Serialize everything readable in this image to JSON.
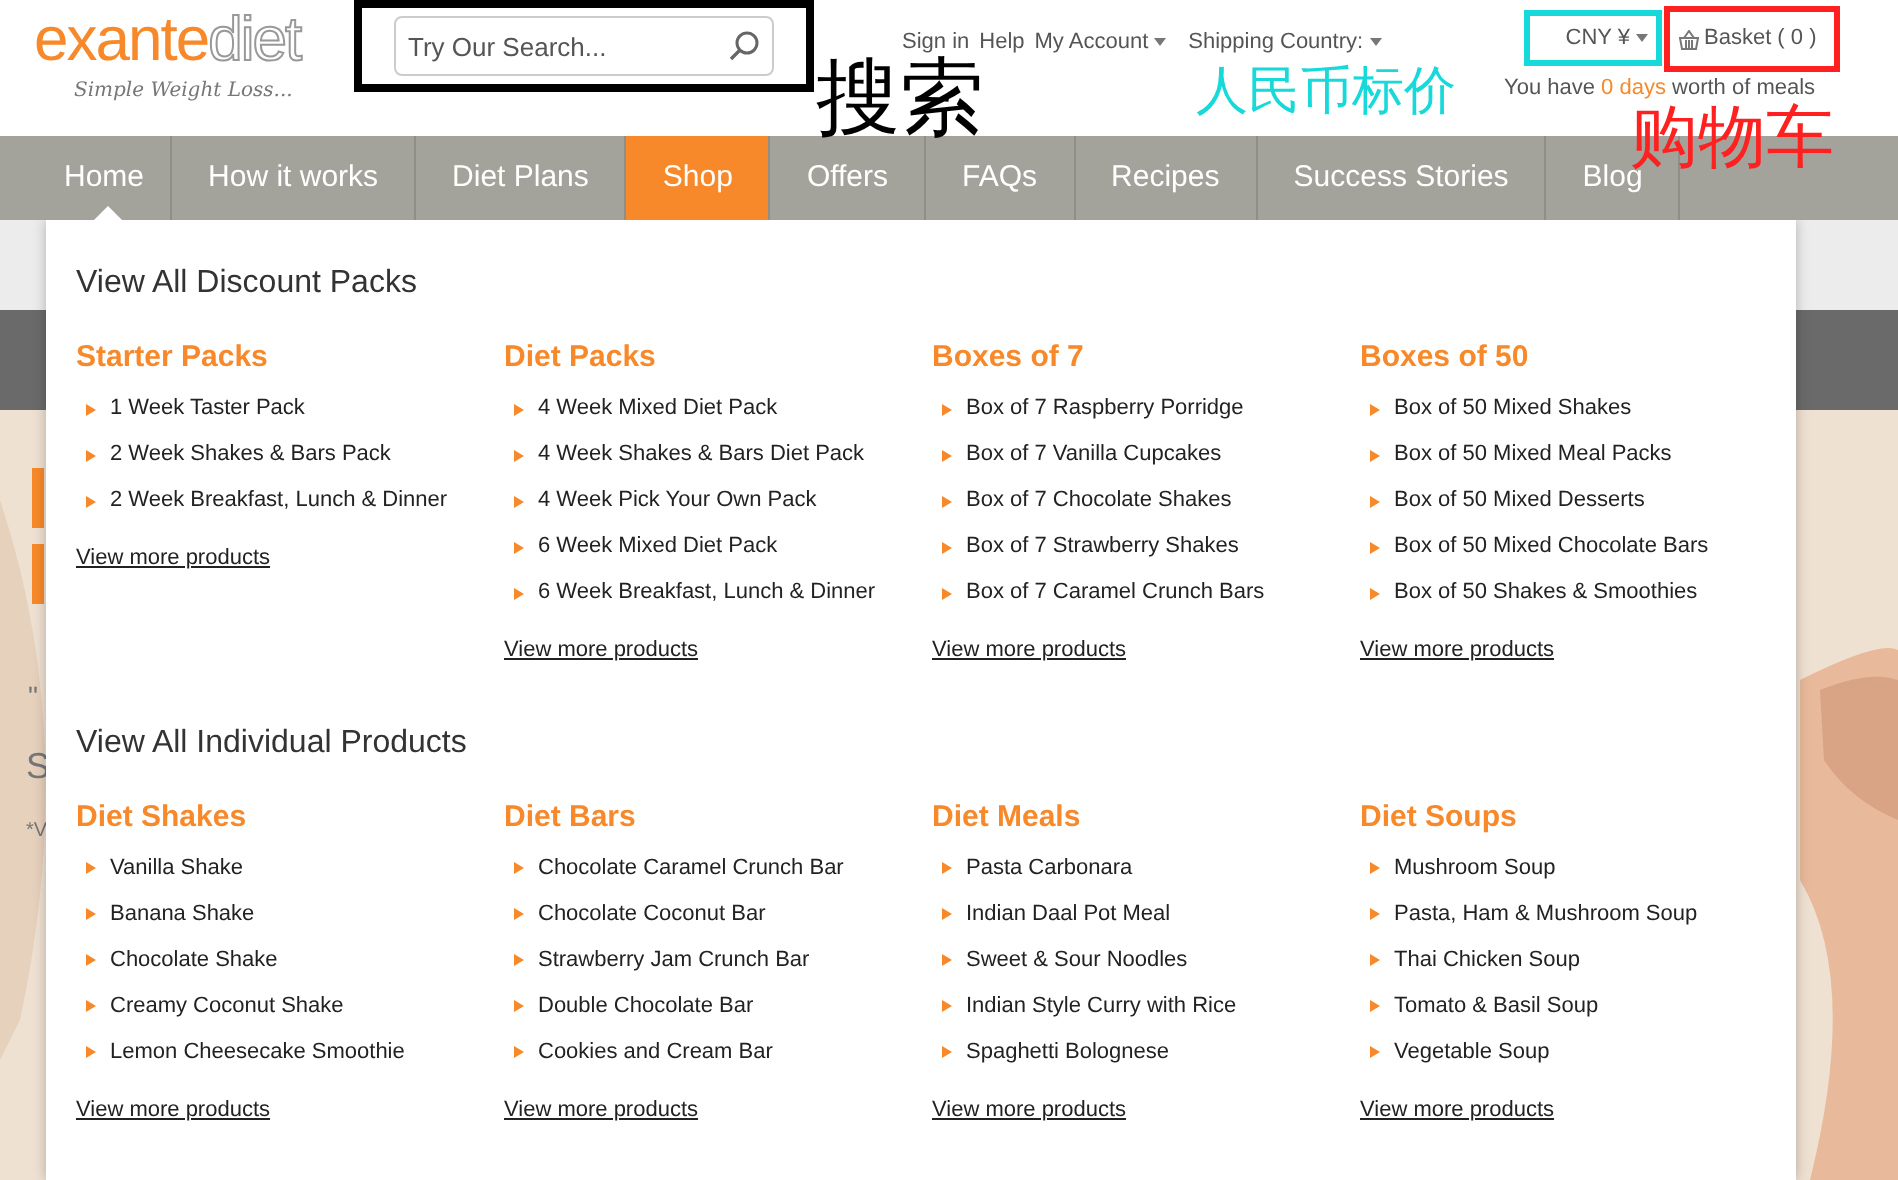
{
  "logo": {
    "word_1": "exante",
    "word_2": "diet",
    "tagline": "Simple Weight Loss..."
  },
  "search": {
    "placeholder": "Try Our Search..."
  },
  "top_links": [
    {
      "label": "Sign in",
      "dropdown": false
    },
    {
      "label": "Help",
      "dropdown": false
    },
    {
      "label": "My Account",
      "dropdown": true
    },
    {
      "label": "Shipping Country:",
      "dropdown": true
    }
  ],
  "currency": {
    "label": "CNY ¥"
  },
  "basket": {
    "label": "Basket ( 0 )"
  },
  "annotation_frames": [
    {
      "color": "#000000"
    },
    {
      "color": "#17d9d9"
    },
    {
      "color": "#ff2020"
    }
  ],
  "meals_note": {
    "before": "You have",
    "highlight": "0 days",
    "after": "worth of meals"
  },
  "nav": [
    {
      "label": "Home",
      "selected": false,
      "current": true
    },
    {
      "label": "How it works",
      "selected": false,
      "current": false
    },
    {
      "label": "Diet Plans",
      "selected": false,
      "current": false
    },
    {
      "label": "Shop",
      "selected": true,
      "current": false
    },
    {
      "label": "Offers",
      "selected": false,
      "current": false
    },
    {
      "label": "FAQs",
      "selected": false,
      "current": false
    },
    {
      "label": "Recipes",
      "selected": false,
      "current": false
    },
    {
      "label": "Success Stories",
      "selected": false,
      "current": false
    },
    {
      "label": "Blog",
      "selected": false,
      "current": false
    }
  ],
  "hero_fragments": [
    "\"",
    "S",
    "*V"
  ],
  "menu_sections": [
    {
      "title": "View All Discount Packs",
      "groups": [
        {
          "title": "Starter Packs",
          "items": [
            "1 Week Taster Pack",
            "2 Week Shakes & Bars Pack",
            "2 Week Breakfast, Lunch & Dinner"
          ],
          "link": "View more products"
        },
        {
          "title": "Diet Packs",
          "items": [
            "4 Week Mixed Diet Pack",
            "4 Week Shakes & Bars Diet Pack",
            "4 Week Pick Your Own Pack",
            "6 Week Mixed Diet Pack",
            "6 Week Breakfast, Lunch & Dinner"
          ],
          "link": "View more products"
        },
        {
          "title": "Boxes of 7",
          "items": [
            "Box of 7 Raspberry Porridge",
            "Box of 7 Vanilla Cupcakes",
            "Box of 7 Chocolate Shakes",
            "Box of 7 Strawberry Shakes",
            "Box of 7 Caramel Crunch Bars"
          ],
          "link": "View more products"
        },
        {
          "title": "Boxes of 50",
          "items": [
            "Box of 50 Mixed Shakes",
            "Box of 50 Mixed Meal Packs",
            "Box of 50 Mixed Desserts",
            "Box of 50 Mixed Chocolate Bars",
            "Box of 50 Shakes & Smoothies"
          ],
          "link": "View more products"
        }
      ]
    },
    {
      "title": "View All Individual Products",
      "groups": [
        {
          "title": "Diet Shakes",
          "items": [
            "Vanilla Shake",
            "Banana Shake",
            "Chocolate Shake",
            "Creamy Coconut Shake",
            "Lemon Cheesecake Smoothie"
          ],
          "link": "View more products"
        },
        {
          "title": "Diet Bars",
          "items": [
            "Chocolate Caramel Crunch Bar",
            "Chocolate Coconut Bar",
            "Strawberry Jam Crunch Bar",
            "Double Chocolate Bar",
            "Cookies and Cream Bar"
          ],
          "link": "View more products"
        },
        {
          "title": "Diet Meals",
          "items": [
            "Pasta Carbonara",
            "Indian Daal Pot Meal",
            "Sweet & Sour Noodles",
            "Indian Style Curry with Rice",
            "Spaghetti Bolognese"
          ],
          "link": "View more products"
        },
        {
          "title": "Diet Soups",
          "items": [
            "Mushroom Soup",
            "Pasta, Ham & Mushroom Soup",
            "Thai Chicken Soup",
            "Tomato & Basil Soup",
            "Vegetable Soup"
          ],
          "link": "View more products"
        }
      ]
    }
  ],
  "annotation_labels": [
    {
      "text": "搜索",
      "color": "#000000"
    },
    {
      "text": "人民币标价",
      "color": "#17d9d9"
    },
    {
      "text": "购物车",
      "color": "#ff2020"
    }
  ]
}
